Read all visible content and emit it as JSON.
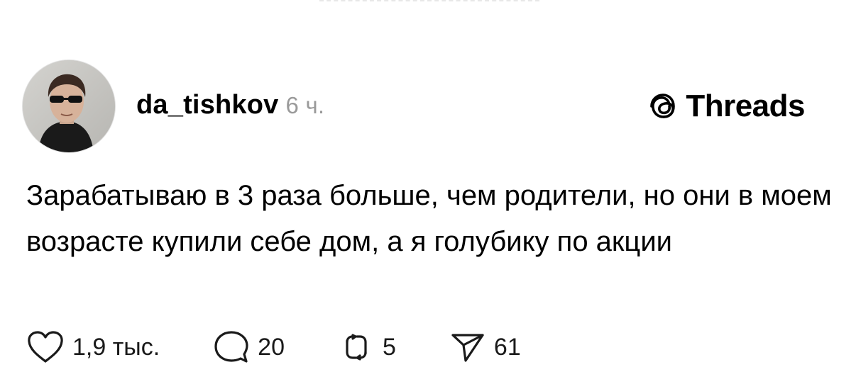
{
  "post": {
    "author": {
      "username": "da_tishkov",
      "time_ago": "6 ч."
    },
    "brand": {
      "label": "Threads",
      "icon": "threads-logo-icon"
    },
    "text": "Зарабатываю в 3 раза больше, чем родители, но они в моем возрасте купили себе дом, а я голубику по акции",
    "actions": {
      "like": {
        "icon": "heart-icon",
        "count": "1,9 тыс."
      },
      "reply": {
        "icon": "comment-icon",
        "count": "20"
      },
      "repost": {
        "icon": "repost-icon",
        "count": "5"
      },
      "share": {
        "icon": "send-icon",
        "count": "61"
      }
    }
  }
}
